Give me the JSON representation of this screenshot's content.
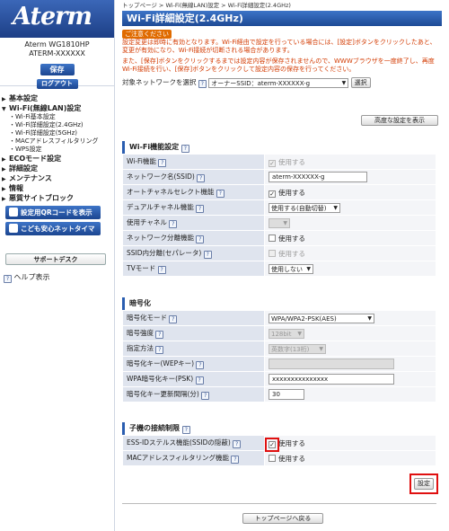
{
  "sidebar": {
    "logo": "Aterm",
    "model": "Aterm WG1810HP",
    "device_name": "ATERM-XXXXXX",
    "save_label": "保存",
    "logout_label": "ログアウト",
    "menu": [
      {
        "label": "基本設定",
        "subs": []
      },
      {
        "label": "Wi-Fi(無線LAN)設定",
        "subs": [
          "・Wi-Fi基本設定",
          "・Wi-Fi詳細設定(2.4GHz)",
          "・Wi-Fi詳細設定(5GHz)",
          "・MACアドレスフィルタリング",
          "・WPS設定"
        ]
      },
      {
        "label": "ECOモード設定",
        "subs": []
      },
      {
        "label": "詳細設定",
        "subs": []
      },
      {
        "label": "メンテナンス",
        "subs": []
      },
      {
        "label": "情報",
        "subs": []
      },
      {
        "label": "悪質サイトブロック",
        "subs": []
      }
    ],
    "qr_button": "設定用QRコードを表示",
    "kids_button": "こども安心ネットタイマー",
    "support_button": "サポートデスク",
    "help_label": "ヘルプ表示"
  },
  "breadcrumb": "トップページ > Wi-Fi(無線LAN)設定 > Wi-Fi詳細設定(2.4GHz)",
  "page_title": "Wi-Fi詳細設定(2.4GHz)",
  "caution": {
    "label": "ご注意ください",
    "line1": "設定変更は即時に有効となります。Wi-Fi経由で設定を行っている場合には、[設定]ボタンをクリックしたあと、変更が有効になり、Wi-Fi接続が切断される場合があります。",
    "line2": "また、[保存]ボタンをクリックするまでは設定内容が保存されませんので、WWWブラウザを一度終了し、再度Wi-Fi接続を行い、[保存]ボタンをクリックして設定内容の保存を行ってください。"
  },
  "network_select": {
    "label": "対象ネットワークを選択",
    "value": "オーナーSSID：aterm-XXXXXX-g",
    "button": "選択"
  },
  "advanced_button": "高度な設定を表示",
  "wifi_section": {
    "title": "Wi-Fi機能設定",
    "rows": [
      {
        "label": "Wi-Fi機能",
        "value": "使用する"
      },
      {
        "label": "ネットワーク名(SSID)",
        "value": "aterm-XXXXXX-g"
      },
      {
        "label": "オートチャネルセレクト機能",
        "value": "使用する"
      },
      {
        "label": "デュアルチャネル機能",
        "value": "使用する(自動切替)"
      },
      {
        "label": "使用チャネル",
        "value": ""
      },
      {
        "label": "ネットワーク分離機能",
        "value": "使用する"
      },
      {
        "label": "SSID内分離(セパレータ)",
        "value": "使用する"
      },
      {
        "label": "TVモード",
        "value": "使用しない"
      }
    ]
  },
  "encrypt_section": {
    "title": "暗号化",
    "rows": [
      {
        "label": "暗号化モード",
        "value": "WPA/WPA2-PSK(AES)"
      },
      {
        "label": "暗号強度",
        "value": "128bit"
      },
      {
        "label": "指定方法",
        "value": "英数字(13桁)"
      },
      {
        "label": "暗号化キー(WEPキー)",
        "value": ""
      },
      {
        "label": "WPA暗号化キー(PSK)",
        "value": "xxxxxxxxxxxxxxx"
      },
      {
        "label": "暗号化キー更新間隔(分)",
        "value": "30"
      }
    ]
  },
  "child_section": {
    "title": "子機の接続制限",
    "rows": [
      {
        "label": "ESS-IDステルス機能(SSIDの隠蔽)",
        "value": "使用する"
      },
      {
        "label": "MACアドレスフィルタリング機能",
        "value": "使用する"
      }
    ]
  },
  "set_button": "設定",
  "back_button": "トップページへ戻る",
  "colors": {
    "brand_blue": "#2a5db0",
    "highlight_red": "#e01010",
    "caution_orange": "#e06b00"
  }
}
